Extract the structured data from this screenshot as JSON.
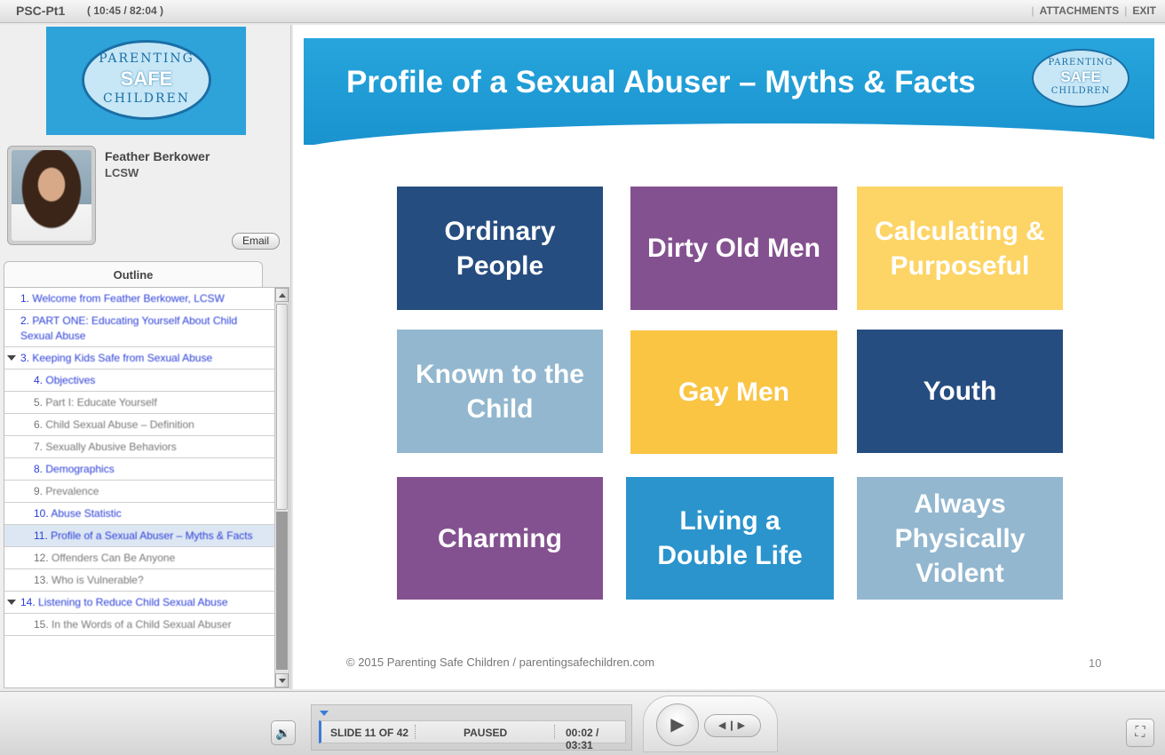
{
  "topbar": {
    "course_title": "PSC-Pt1",
    "course_time": "( 10:45 / 82:04 )",
    "attachments": "ATTACHMENTS",
    "exit": "EXIT"
  },
  "logo": {
    "line1": "PARENTING",
    "line2": "SAFE",
    "line3": "CHILDREN"
  },
  "presenter": {
    "name": "Feather Berkower",
    "credentials": "LCSW",
    "email_label": "Email"
  },
  "outline": {
    "tab_label": "Outline",
    "items": [
      {
        "num": "1.",
        "label": "Welcome from Feather Berkower, LCSW",
        "level": 1,
        "style": "link"
      },
      {
        "num": "2.",
        "label": "PART ONE: Educating Yourself About Child Sexual Abuse",
        "level": 1,
        "style": "link"
      },
      {
        "num": "3.",
        "label": "Keeping Kids Safe from Sexual Abuse",
        "level": 1,
        "style": "link",
        "expanded": true
      },
      {
        "num": "4.",
        "label": "Objectives",
        "level": 2,
        "style": "link"
      },
      {
        "num": "5.",
        "label": "Part I: Educate Yourself",
        "level": 2,
        "style": "grey"
      },
      {
        "num": "6.",
        "label": "Child Sexual Abuse – Definition",
        "level": 2,
        "style": "grey"
      },
      {
        "num": "7.",
        "label": "Sexually Abusive Behaviors",
        "level": 2,
        "style": "grey"
      },
      {
        "num": "8.",
        "label": "Demographics",
        "level": 2,
        "style": "link"
      },
      {
        "num": "9.",
        "label": "Prevalence",
        "level": 2,
        "style": "grey"
      },
      {
        "num": "10.",
        "label": "Abuse Statistic",
        "level": 2,
        "style": "link"
      },
      {
        "num": "11.",
        "label": "Profile of a Sexual Abuser – Myths & Facts",
        "level": 2,
        "style": "link",
        "active": true
      },
      {
        "num": "12.",
        "label": "Offenders Can Be Anyone",
        "level": 2,
        "style": "grey"
      },
      {
        "num": "13.",
        "label": "Who is Vulnerable?",
        "level": 2,
        "style": "grey"
      },
      {
        "num": "14.",
        "label": "Listening to Reduce Child Sexual Abuse",
        "level": 1,
        "style": "link",
        "expanded": true
      },
      {
        "num": "15.",
        "label": "In the Words of a Child Sexual Abuser",
        "level": 2,
        "style": "grey"
      }
    ]
  },
  "slide": {
    "title": "Profile of a Sexual Abuser – Myths & Facts",
    "tiles": [
      {
        "label": "Ordinary People",
        "color": "#264d80"
      },
      {
        "label": "Dirty Old Men",
        "color": "#845190"
      },
      {
        "label": "Calculating & Purposeful",
        "color": "#fdd466"
      },
      {
        "label": "Known to the Child",
        "color": "#93b7cf"
      },
      {
        "label": "Gay Men",
        "color": "#fac543"
      },
      {
        "label": "Youth",
        "color": "#264d80"
      },
      {
        "label": "Charming",
        "color": "#845190"
      },
      {
        "label": "Living a Double Life",
        "color": "#2b94cd"
      },
      {
        "label": "Always Physically Violent",
        "color": "#93b7cf"
      }
    ],
    "footer": "© 2015 Parenting Safe Children / parentingsafechildren.com",
    "page_number": "10"
  },
  "player": {
    "slide_indicator": "SLIDE 11 OF 42",
    "state": "PAUSED",
    "time": "00:02 / 03:31",
    "volume_icon": "speaker-icon",
    "play_icon": "play-icon",
    "seek_icon": "seek-icon",
    "fullscreen_icon": "fullscreen-icon"
  },
  "colors": {
    "header_blue": "#1f9ad6",
    "link_blue": "#2b3fd8",
    "progress_blue": "#3b7bd8"
  }
}
